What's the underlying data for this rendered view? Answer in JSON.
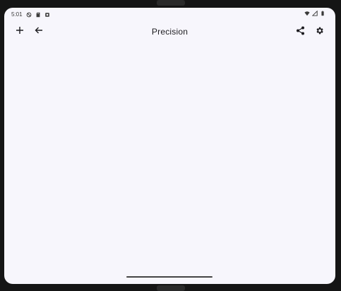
{
  "status_bar": {
    "time": "5:01",
    "left_icons": [
      "do-not-disturb-icon",
      "sd-card-icon",
      "app-notification-icon"
    ],
    "right_icons": [
      "wifi-icon",
      "signal-icon",
      "battery-icon"
    ]
  },
  "app_bar": {
    "title": "Precision",
    "left_actions": [
      "add-icon",
      "back-arrow-icon"
    ],
    "right_actions": [
      "share-icon",
      "settings-icon"
    ]
  }
}
